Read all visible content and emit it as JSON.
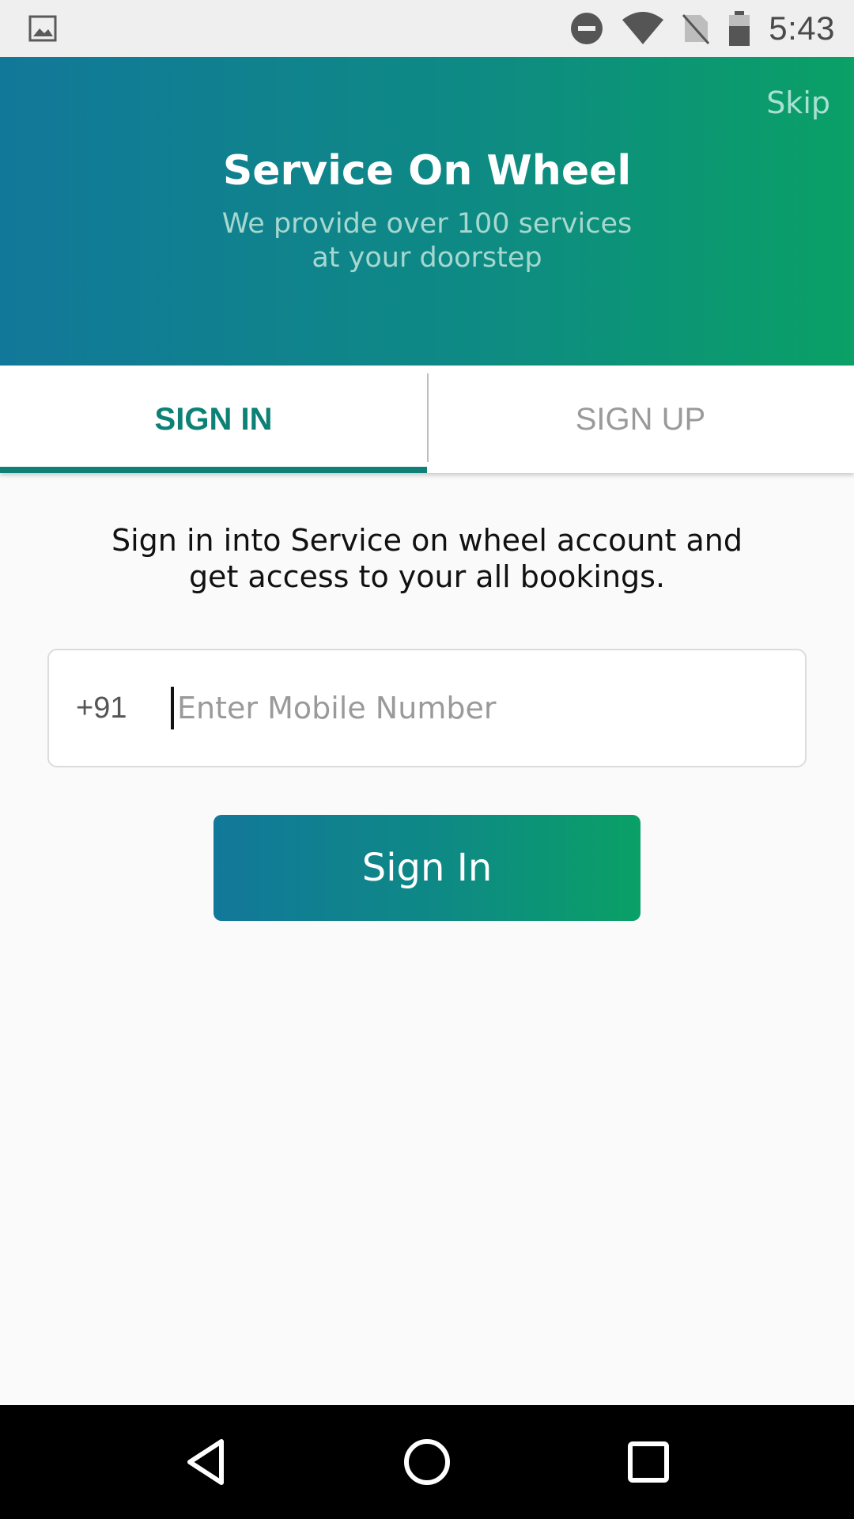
{
  "status_bar": {
    "time": "5:43",
    "icons": [
      "image-icon",
      "do-not-disturb-icon",
      "wifi-icon",
      "no-sim-icon",
      "battery-icon"
    ]
  },
  "header": {
    "skip_label": "Skip",
    "title": "Service On Wheel",
    "subtitle": "We provide over 100 services\nat your doorstep",
    "gradient": [
      "#12789a",
      "#0e8a84",
      "#0aa066"
    ]
  },
  "tabs": [
    {
      "label": "SIGN IN",
      "active": true
    },
    {
      "label": "SIGN UP",
      "active": false
    }
  ],
  "sign_in": {
    "intro": "Sign in into Service on wheel account and\nget access to your all bookings.",
    "country_code": "+91",
    "mobile_placeholder": "Enter Mobile Number",
    "mobile_value": "",
    "button_label": "Sign In"
  },
  "colors": {
    "accent": "#0d8175",
    "inactive_tab": "#9a9a9a",
    "background": "#fafafa"
  },
  "nav_bar": {
    "icons": [
      "back-icon",
      "home-icon",
      "recents-icon"
    ]
  }
}
